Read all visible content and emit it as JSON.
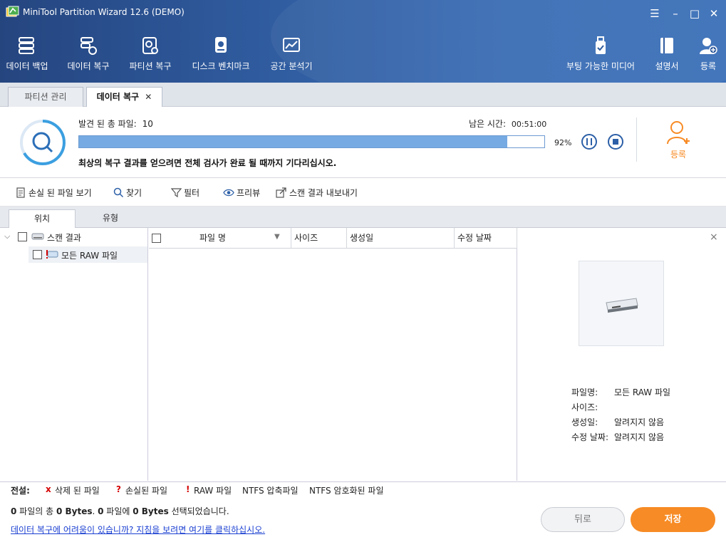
{
  "window": {
    "title": "MiniTool Partition Wizard 12.6 (DEMO)",
    "controls": [
      "☰",
      "–",
      "□",
      "✕"
    ]
  },
  "toolbar": {
    "items": [
      {
        "label": "데이터 백업",
        "icon": "backup-icon"
      },
      {
        "label": "데이터 복구",
        "icon": "data-recovery-icon"
      },
      {
        "label": "파티션 복구",
        "icon": "partition-recovery-icon"
      },
      {
        "label": "디스크 벤치마크",
        "icon": "disk-benchmark-icon"
      },
      {
        "label": "공간 분석기",
        "icon": "space-analyzer-icon"
      }
    ],
    "right_items": [
      {
        "label": "부팅 가능한 미디어",
        "icon": "bootable-media-icon"
      },
      {
        "label": "설명서",
        "icon": "manual-icon"
      },
      {
        "label": "등록",
        "icon": "register-icon"
      }
    ]
  },
  "tabs": {
    "partition": "파티션 관리",
    "recovery": "데이터 복구",
    "close": "✕"
  },
  "scan": {
    "found_label": "발견 된 총 파일:",
    "found_count": "10",
    "remaining_label": "남은 시간:",
    "remaining_time": "00:51:00",
    "progress_fraction": 0.92,
    "progress_text": "92%",
    "message": "최상의 복구 결과를 얻으려면 전체 검사가 완료 될 때까지 기다리십시오.",
    "register_label": "등록"
  },
  "actions": {
    "lost_files": "손실 된 파일 보기",
    "find": "찾기",
    "filter": "필터",
    "preview": "프리뷰",
    "export": "스캔 결과 내보내기"
  },
  "subtabs": {
    "location": "위치",
    "type": "유형"
  },
  "tree": {
    "root": "스캔 결과",
    "child": "모든 RAW 파일"
  },
  "filelist": {
    "columns": [
      "파일 명",
      "사이즈",
      "생성일",
      "수정 날짜"
    ]
  },
  "preview_panel": {
    "close": "×",
    "meta": [
      {
        "key": "파일명:",
        "value": "모든 RAW 파일"
      },
      {
        "key": "사이즈:",
        "value": ""
      },
      {
        "key": "생성일:",
        "value": "알려지지 않음"
      },
      {
        "key": "수정 날짜:",
        "value": "알려지지 않음"
      }
    ]
  },
  "legend": {
    "title": "전설:",
    "deleted_mark": "x",
    "deleted": "삭제 된 파일",
    "lost_mark": "?",
    "lost": "손실된 파일",
    "raw_mark": "!",
    "raw": "RAW 파일",
    "ntfs_compressed": "NTFS 압축파일",
    "ntfs_encrypted": "NTFS 암호화된 파일"
  },
  "footer": {
    "summary_a": "0",
    "summary_b": " 파일의 총 ",
    "summary_c": "0 Bytes",
    "summary_d": ". ",
    "summary_e": "0",
    "summary_f": " 파일에 ",
    "summary_g": "0 Bytes",
    "summary_h": " 선택되었습니다.",
    "help_link": "데이터 복구에 어려움이 있습니까? 지침을 보려면 여기를 클릭하십시오.",
    "back": "뒤로",
    "save": "저장"
  },
  "colors": {
    "accent": "#2f5b9e",
    "progress": "#76aae2",
    "orange": "#f78b25",
    "red": "#d40000"
  }
}
